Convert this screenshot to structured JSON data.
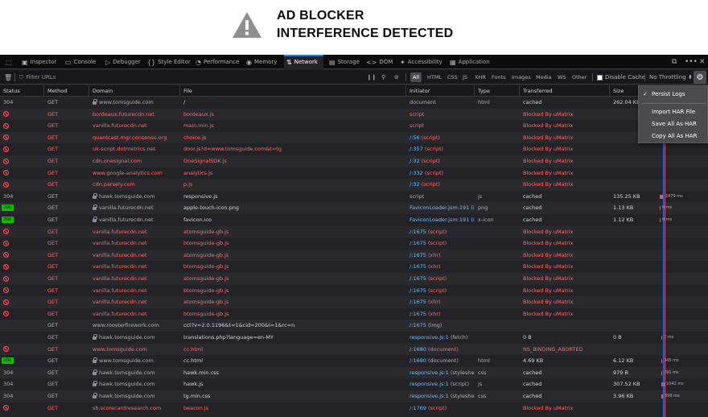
{
  "banner": {
    "line1": "AD BLOCKER",
    "line2": "INTERFERENCE DETECTED"
  },
  "toolbox": {
    "tabs": [
      {
        "label": "Inspector",
        "icon": "inspector-icon"
      },
      {
        "label": "Console",
        "icon": "console-icon"
      },
      {
        "label": "Debugger",
        "icon": "debugger-icon"
      },
      {
        "label": "Style Editor",
        "icon": "style-editor-icon"
      },
      {
        "label": "Performance",
        "icon": "performance-icon"
      },
      {
        "label": "Memory",
        "icon": "memory-icon"
      },
      {
        "label": "Network",
        "icon": "network-icon"
      },
      {
        "label": "Storage",
        "icon": "storage-icon"
      },
      {
        "label": "DOM",
        "icon": "dom-icon"
      },
      {
        "label": "Accessibility",
        "icon": "accessibility-icon"
      },
      {
        "label": "Application",
        "icon": "application-icon"
      }
    ],
    "selected": "Network"
  },
  "filter": {
    "placeholder": "Filter URLs",
    "types": [
      "All",
      "HTML",
      "CSS",
      "JS",
      "XHR",
      "Fonts",
      "Images",
      "Media",
      "WS",
      "Other"
    ],
    "selected_type": "All",
    "disable_cache_label": "Disable Cache",
    "throttling_label": "No Throttling ⬍"
  },
  "columns": [
    "Status",
    "Method",
    "Domain",
    "File",
    "Initiator",
    "Type",
    "Transferred",
    "Size"
  ],
  "rows": [
    {
      "status": "304",
      "method": "GET",
      "domain": "www.tomsguide.com",
      "secure": true,
      "file": "/",
      "initiator": "document",
      "type": "html",
      "transferred": "cached",
      "size": "262.04 KB",
      "blocked": false
    },
    {
      "status": "blocked",
      "method": "GET",
      "domain": "bordeaux.futurecdn.net",
      "file": "bordeaux.js",
      "initiator": "script",
      "type": "",
      "transferred": "Blocked By uMatrix",
      "size": "",
      "blocked": true
    },
    {
      "status": "blocked",
      "method": "GET",
      "domain": "vanilla.futurecdn.net",
      "file": "main.min.js",
      "initiator": "script",
      "type": "",
      "transferred": "Blocked By uMatrix",
      "size": "",
      "blocked": true
    },
    {
      "status": "blocked",
      "method": "GET",
      "domain": "quantcast.mgr.consensu.org",
      "file": "choice.js",
      "initiator": "/:56",
      "initiator_extra": " (script)",
      "type": "",
      "transferred": "Blocked By uMatrix",
      "size": "",
      "blocked": true
    },
    {
      "status": "blocked",
      "method": "GET",
      "domain": "uk-script.dotmetrics.net",
      "file": "door.js?d=www.tomsguide.com&t=tg",
      "initiator": "/:357",
      "initiator_extra": " (script)",
      "type": "",
      "transferred": "Blocked By uMatrix",
      "size": "",
      "blocked": true
    },
    {
      "status": "blocked",
      "method": "GET",
      "domain": "cdn.onesignal.com",
      "file": "OneSignalSDK.js",
      "initiator": "/:32",
      "initiator_extra": " (script)",
      "type": "",
      "transferred": "Blocked By uMatrix",
      "size": "",
      "blocked": true
    },
    {
      "status": "blocked",
      "method": "GET",
      "domain": "www.google-analytics.com",
      "file": "analytics.js",
      "initiator": "/:332",
      "initiator_extra": " (script)",
      "type": "",
      "transferred": "Blocked By uMatrix",
      "size": "",
      "blocked": true
    },
    {
      "status": "blocked",
      "method": "GET",
      "domain": "cdn.parsely.com",
      "file": "p.js",
      "initiator": "/:32",
      "initiator_extra": " (script)",
      "type": "",
      "transferred": "Blocked By uMatrix",
      "size": "",
      "blocked": true
    },
    {
      "status": "304",
      "method": "GET",
      "domain": "hawk.tomsguide.com",
      "secure": true,
      "file": "responsive.js",
      "initiator": "script",
      "type": "js",
      "transferred": "cached",
      "size": "135.25 KB",
      "timing": "1979 ms",
      "blocked": false
    },
    {
      "status": "200",
      "method": "GET",
      "domain": "vanilla.futurecdn.net",
      "secure": true,
      "file": "apple-touch-icon.png",
      "initiator": "FaviconLoader.jsm:191 (i...",
      "type": "png",
      "transferred": "cached",
      "size": "1.13 KB",
      "timing": "0 ms",
      "blocked": false
    },
    {
      "status": "200",
      "method": "GET",
      "domain": "vanilla.futurecdn.net",
      "secure": true,
      "file": "favicon.ico",
      "initiator": "FaviconLoader.jsm:191 (i...",
      "type": "x-icon",
      "transferred": "cached",
      "size": "1.12 KB",
      "timing": "0 ms",
      "blocked": false
    },
    {
      "status": "blocked",
      "method": "GET",
      "domain": "vanilla.futurecdn.net",
      "file": "atomsguide-gb.js",
      "initiator": "/:1675",
      "initiator_extra": " (script)",
      "type": "",
      "transferred": "Blocked By uMatrix",
      "size": "",
      "blocked": true
    },
    {
      "status": "blocked",
      "method": "GET",
      "domain": "vanilla.futurecdn.net",
      "file": "btomsguide-gb.js",
      "initiator": "/:1675",
      "initiator_extra": " (script)",
      "type": "",
      "transferred": "Blocked By uMatrix",
      "size": "",
      "blocked": true
    },
    {
      "status": "blocked",
      "method": "GET",
      "domain": "vanilla.futurecdn.net",
      "file": "atomsguide-gb.js",
      "initiator": "/:1675",
      "initiator_extra": " (xhr)",
      "type": "",
      "transferred": "Blocked By uMatrix",
      "size": "",
      "blocked": true
    },
    {
      "status": "blocked",
      "method": "GET",
      "domain": "vanilla.futurecdn.net",
      "file": "btomsguide-gb.js",
      "initiator": "/:1675",
      "initiator_extra": " (xhr)",
      "type": "",
      "transferred": "Blocked By uMatrix",
      "size": "",
      "blocked": true
    },
    {
      "status": "blocked",
      "method": "GET",
      "domain": "vanilla.futurecdn.net",
      "file": "atomsguide-gb.js",
      "initiator": "/:1675",
      "initiator_extra": " (script)",
      "type": "",
      "transferred": "Blocked By uMatrix",
      "size": "",
      "blocked": true
    },
    {
      "status": "blocked",
      "method": "GET",
      "domain": "vanilla.futurecdn.net",
      "file": "btomsguide-gb.js",
      "initiator": "/:1675",
      "initiator_extra": " (script)",
      "type": "",
      "transferred": "Blocked By uMatrix",
      "size": "",
      "blocked": true
    },
    {
      "status": "blocked",
      "method": "GET",
      "domain": "vanilla.futurecdn.net",
      "file": "atomsguide-gb.js",
      "initiator": "/:1675",
      "initiator_extra": " (xhr)",
      "type": "",
      "transferred": "Blocked By uMatrix",
      "size": "",
      "blocked": true
    },
    {
      "status": "blocked",
      "method": "GET",
      "domain": "vanilla.futurecdn.net",
      "file": "btomsguide-gb.js",
      "initiator": "/:1675",
      "initiator_extra": " (xhr)",
      "type": "",
      "transferred": "Blocked By uMatrix",
      "size": "",
      "blocked": true
    },
    {
      "status": "",
      "method": "GET",
      "domain": "www.roosterfirework.com",
      "file": "cct?v=2.0.1196&t=1&cid=200&l=1&rc=n",
      "initiator": "/:1675",
      "initiator_extra": " (img)",
      "type": "",
      "transferred": "",
      "size": "",
      "blocked": false
    },
    {
      "status": "",
      "method": "GET",
      "domain": "hawk.tomsguide.com",
      "secure": true,
      "file": "translations.php?language=en-MY",
      "initiator": "responsive.js:1",
      "initiator_extra": " (fetch)",
      "type": "",
      "transferred": "0 B",
      "size": "0 B",
      "timing": "2 ms",
      "blocked": false
    },
    {
      "status": "blocked",
      "method": "GET",
      "domain": "www.tomsguide.com",
      "file": "cc.html",
      "initiator": "/:1680",
      "initiator_extra": " (document)",
      "type": "",
      "transferred": "NS_BINDING_ABORTED",
      "size": "",
      "blocked": true
    },
    {
      "status": "200",
      "method": "GET",
      "domain": "www.tomsguide.com",
      "secure": true,
      "file": "cc.html",
      "initiator": "/:1680",
      "initiator_extra": " (document)",
      "type": "html",
      "transferred": "4.69 KB",
      "size": "6.12 KB",
      "timing": "345 ms",
      "blocked": false
    },
    {
      "status": "304",
      "method": "GET",
      "domain": "hawk.tomsguide.com",
      "secure": true,
      "file": "hawk.min.css",
      "initiator": "responsive.js:1",
      "initiator_extra": " (stylesheet)",
      "type": "css",
      "transferred": "cached",
      "size": "979 B",
      "timing": "291 ms",
      "blocked": false
    },
    {
      "status": "304",
      "method": "GET",
      "domain": "hawk.tomsguide.com",
      "secure": true,
      "file": "hawk.js",
      "initiator": "responsive.js:1",
      "initiator_extra": " (script)",
      "type": "js",
      "transferred": "cached",
      "size": "307.52 KB",
      "timing": "1042 ms",
      "blocked": false
    },
    {
      "status": "304",
      "method": "GET",
      "domain": "hawk.tomsguide.com",
      "secure": true,
      "file": "tg.min.css",
      "initiator": "responsive.js:1",
      "initiator_extra": " (stylesheet)",
      "type": "css",
      "transferred": "cached",
      "size": "3.96 KB",
      "timing": "399 ms",
      "blocked": false
    },
    {
      "status": "blocked",
      "method": "GET",
      "domain": "sb.scorecardresearch.com",
      "file": "beacon.js",
      "initiator": "/:1769",
      "initiator_extra": " (script)",
      "type": "",
      "transferred": "Blocked By uMatrix",
      "size": "",
      "blocked": true
    }
  ],
  "menu": {
    "items": [
      {
        "label": "Persist Logs",
        "checked": true
      },
      {
        "label": "Import HAR File"
      },
      {
        "label": "Save All As HAR"
      },
      {
        "label": "Copy All As HAR"
      }
    ]
  },
  "colors": {
    "accent": "#0a84ff",
    "blocked": "#ff6b6b",
    "link": "#75bfff",
    "ok": "#12bc00"
  }
}
